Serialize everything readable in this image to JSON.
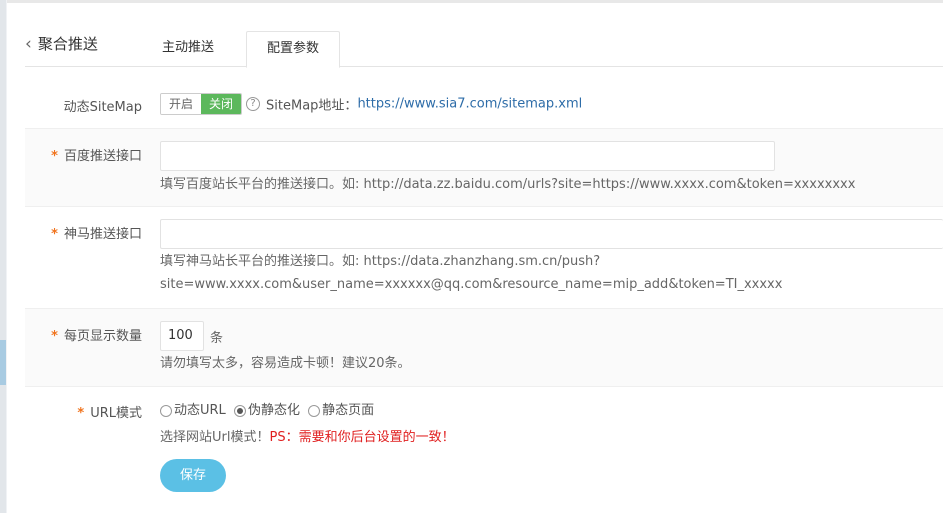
{
  "header": {
    "back_title": "聚合推送",
    "tabs": [
      {
        "label": "主动推送"
      },
      {
        "label": "配置参数"
      }
    ]
  },
  "sitemap": {
    "label": "动态SiteMap",
    "switch_on": "开启",
    "switch_off": "关闭",
    "switch_state": "关闭",
    "address_label": "SiteMap地址：",
    "address_url": "https://www.sia7.com/sitemap.xml"
  },
  "baidu": {
    "required": "*",
    "label": "百度推送接口",
    "value": "",
    "hint": "填写百度站长平台的推送接口。如: http://data.zz.baidu.com/urls?site=https://www.xxxx.com&token=xxxxxxxx"
  },
  "shenma": {
    "required": "*",
    "label": "神马推送接口",
    "value": "",
    "hint_line1": "填写神马站长平台的推送接口。如: https://data.zhanzhang.sm.cn/push?",
    "hint_line2": "site=www.xxxx.com&user_name=xxxxxx@qq.com&resource_name=mip_add&token=TI_xxxxx"
  },
  "per_page": {
    "required": "*",
    "label": "每页显示数量",
    "value": "100",
    "unit": "条",
    "hint": "请勿填写太多，容易造成卡顿！建议20条。"
  },
  "url_mode": {
    "required": "*",
    "label": "URL模式",
    "options": [
      {
        "label": "动态URL",
        "selected": false
      },
      {
        "label": "伪静态化",
        "selected": true
      },
      {
        "label": "静态页面",
        "selected": false
      }
    ],
    "hint": "选择网站Url模式！",
    "warning": "PS：需要和你后台设置的一致！"
  },
  "save_label": "保存",
  "colors": {
    "switch_off_bg": "#5cb85c",
    "save_bg": "#5bc0e5",
    "required_star": "#f0731d",
    "warning": "#e02020",
    "link": "#2d6ca8"
  }
}
